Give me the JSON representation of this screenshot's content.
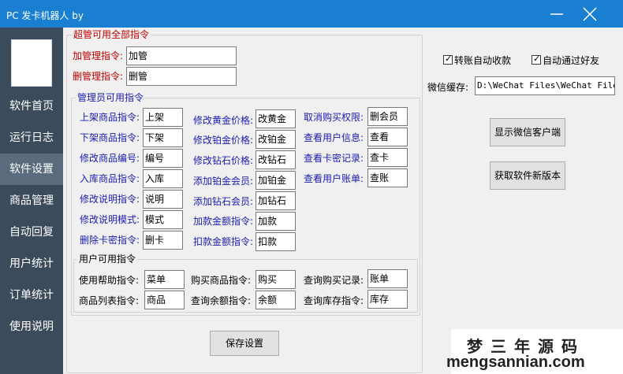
{
  "window": {
    "title": "PC 发卡机器人 by"
  },
  "sidebar": {
    "items": [
      {
        "label": "软件首页"
      },
      {
        "label": "运行日志"
      },
      {
        "label": "软件设置"
      },
      {
        "label": "商品管理"
      },
      {
        "label": "自动回复"
      },
      {
        "label": "用户统计"
      },
      {
        "label": "订单统计"
      },
      {
        "label": "使用说明"
      }
    ]
  },
  "super_admin": {
    "title": "超管可用全部指令",
    "add_label": "加管理指令:",
    "add_value": "加管",
    "del_label": "删管理指令:",
    "del_value": "删管"
  },
  "admin": {
    "title": "管理员可用指令",
    "col1": [
      {
        "label": "上架商品指令:",
        "value": "上架"
      },
      {
        "label": "下架商品指令:",
        "value": "下架"
      },
      {
        "label": "修改商品编号:",
        "value": "编号"
      },
      {
        "label": "入库商品指令:",
        "value": "入库"
      },
      {
        "label": "修改说明指令:",
        "value": "说明"
      },
      {
        "label": "修改说明模式:",
        "value": "模式"
      },
      {
        "label": "删除卡密指令:",
        "value": "删卡"
      }
    ],
    "col2": [
      {
        "label": "修改黄金价格:",
        "value": "改黄金"
      },
      {
        "label": "修改铂金价格:",
        "value": "改铂金"
      },
      {
        "label": "修改钻石价格:",
        "value": "改钻石"
      },
      {
        "label": "添加铂金会员:",
        "value": "加铂金"
      },
      {
        "label": "添加钻石会员:",
        "value": "加钻石"
      },
      {
        "label": "加款金额指令:",
        "value": "加款"
      },
      {
        "label": "扣款金额指令:",
        "value": "扣款"
      }
    ],
    "col3": [
      {
        "label": "取消购买权限:",
        "value": "删会员"
      },
      {
        "label": "查看用户信息:",
        "value": "查看"
      },
      {
        "label": "查看卡密记录:",
        "value": "查卡"
      },
      {
        "label": "查看用户账单:",
        "value": "查账"
      }
    ]
  },
  "user": {
    "title": "用户可用指令",
    "items": [
      {
        "label": "使用帮助指令:",
        "value": "菜单"
      },
      {
        "label": "购买商品指令:",
        "value": "购买"
      },
      {
        "label": "查询购买记录:",
        "value": "账单"
      },
      {
        "label": "商品列表指令:",
        "value": "商品"
      },
      {
        "label": "查询余额指令:",
        "value": "余额"
      },
      {
        "label": "查询库存指令:",
        "value": "库存"
      }
    ]
  },
  "save_button": "保存设置",
  "right": {
    "transfer_label": "转账自动收款",
    "friend_label": "自动通过好友",
    "cache_label": "微信缓存:",
    "cache_value": "D:\\WeChat Files\\WeChat Files",
    "show_wechat_button": "显示微信客户端",
    "get_version_button": "获取软件新版本"
  },
  "watermark": {
    "line1": "梦三年源码",
    "line2": "mengsannian.com"
  },
  "colors": {
    "titlebar": "#1b7fd1",
    "sidebar": "#3c4b5c",
    "sidebar_active": "#5a6b7d",
    "red_label": "#c00000",
    "blue_label": "#1b1bb3"
  }
}
